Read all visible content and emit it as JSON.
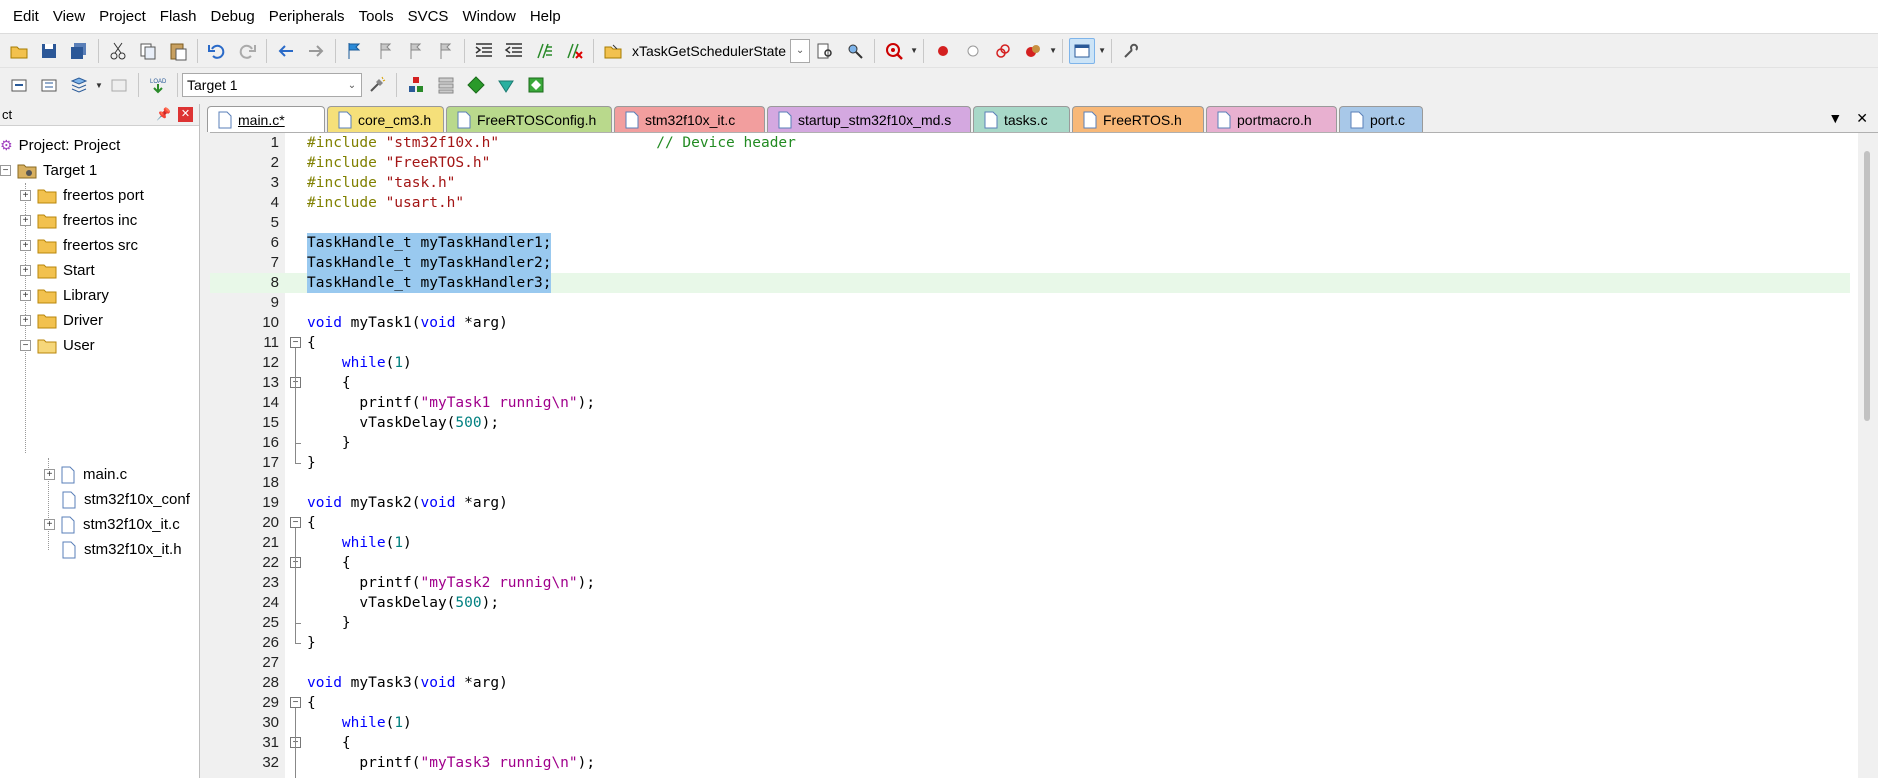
{
  "menu": [
    "Edit",
    "View",
    "Project",
    "Flash",
    "Debug",
    "Peripherals",
    "Tools",
    "SVCS",
    "Window",
    "Help"
  ],
  "toolbar": {
    "function_combo": "xTaskGetSchedulerState",
    "target_combo": "Target 1"
  },
  "project_panel": {
    "title": "ct",
    "pin": "📌",
    "close": "✕",
    "root": "Project: Project",
    "target": "Target 1",
    "groups": [
      "freertos port",
      "freertos inc",
      "freertos src",
      "Start",
      "Library",
      "Driver",
      "User"
    ],
    "user_files": [
      "main.c",
      "stm32f10x_conf",
      "stm32f10x_it.c",
      "stm32f10x_it.h"
    ]
  },
  "tabs": [
    {
      "label": "main.c*",
      "color": "#ffffff",
      "active": true
    },
    {
      "label": "core_cm3.h",
      "color": "#f5e07a"
    },
    {
      "label": "FreeRTOSConfig.h",
      "color": "#b9d98c"
    },
    {
      "label": "stm32f10x_it.c",
      "color": "#f29e9e"
    },
    {
      "label": "startup_stm32f10x_md.s",
      "color": "#d4a8e0"
    },
    {
      "label": "tasks.c",
      "color": "#a8d8c8"
    },
    {
      "label": "FreeRTOS.h",
      "color": "#f8b878"
    },
    {
      "label": "portmacro.h",
      "color": "#e8b0d0"
    },
    {
      "label": "port.c",
      "color": "#a8c8e8"
    }
  ],
  "tab_tools": {
    "dropdown": "▼",
    "close": "✕"
  },
  "editor": {
    "lines": [
      {
        "n": "1",
        "segs": [
          [
            "pp",
            "#include "
          ],
          [
            "str",
            "\"stm32f10x.h\""
          ],
          [
            "",
            "                  "
          ],
          [
            "cmt",
            "// Device header"
          ]
        ]
      },
      {
        "n": "2",
        "segs": [
          [
            "pp",
            "#include "
          ],
          [
            "str",
            "\"FreeRTOS.h\""
          ]
        ]
      },
      {
        "n": "3",
        "segs": [
          [
            "pp",
            "#include "
          ],
          [
            "str",
            "\"task.h\""
          ]
        ]
      },
      {
        "n": "4",
        "segs": [
          [
            "pp",
            "#include "
          ],
          [
            "str",
            "\"usart.h\""
          ]
        ]
      },
      {
        "n": "5",
        "segs": []
      },
      {
        "n": "6",
        "segs": [
          [
            "",
            "TaskHandle_t myTaskHandler1;"
          ]
        ],
        "sel": true
      },
      {
        "n": "7",
        "segs": [
          [
            "",
            "TaskHandle_t myTaskHandler2;"
          ]
        ],
        "sel": true
      },
      {
        "n": "8",
        "segs": [
          [
            "",
            "TaskHandle_t myTaskHandler3;"
          ]
        ],
        "sel": true,
        "current": true
      },
      {
        "n": "9",
        "segs": []
      },
      {
        "n": "10",
        "segs": [
          [
            "kw",
            "void"
          ],
          [
            "",
            " myTask1("
          ],
          [
            "kw",
            "void"
          ],
          [
            "",
            " *arg)"
          ]
        ]
      },
      {
        "n": "11",
        "segs": [
          [
            "",
            "{"
          ]
        ],
        "fold": "open"
      },
      {
        "n": "12",
        "segs": [
          [
            "",
            "    "
          ],
          [
            "kw",
            "while"
          ],
          [
            "",
            "("
          ],
          [
            "num",
            "1"
          ],
          [
            "",
            ")"
          ]
        ]
      },
      {
        "n": "13",
        "segs": [
          [
            "",
            "    {"
          ]
        ],
        "fold": "open"
      },
      {
        "n": "14",
        "segs": [
          [
            "",
            "      printf("
          ],
          [
            "str2",
            "\"myTask1 runnig\\n\""
          ],
          [
            "",
            ");"
          ]
        ]
      },
      {
        "n": "15",
        "segs": [
          [
            "",
            "      vTaskDelay("
          ],
          [
            "num",
            "500"
          ],
          [
            "",
            ");"
          ]
        ]
      },
      {
        "n": "16",
        "segs": [
          [
            "",
            "    }"
          ]
        ]
      },
      {
        "n": "17",
        "segs": [
          [
            "",
            "}"
          ]
        ]
      },
      {
        "n": "18",
        "segs": []
      },
      {
        "n": "19",
        "segs": [
          [
            "kw",
            "void"
          ],
          [
            "",
            " myTask2("
          ],
          [
            "kw",
            "void"
          ],
          [
            "",
            " *arg)"
          ]
        ]
      },
      {
        "n": "20",
        "segs": [
          [
            "",
            "{"
          ]
        ],
        "fold": "open"
      },
      {
        "n": "21",
        "segs": [
          [
            "",
            "    "
          ],
          [
            "kw",
            "while"
          ],
          [
            "",
            "("
          ],
          [
            "num",
            "1"
          ],
          [
            "",
            ")"
          ]
        ]
      },
      {
        "n": "22",
        "segs": [
          [
            "",
            "    {"
          ]
        ],
        "fold": "open"
      },
      {
        "n": "23",
        "segs": [
          [
            "",
            "      printf("
          ],
          [
            "str2",
            "\"myTask2 runnig\\n\""
          ],
          [
            "",
            ");"
          ]
        ]
      },
      {
        "n": "24",
        "segs": [
          [
            "",
            "      vTaskDelay("
          ],
          [
            "num",
            "500"
          ],
          [
            "",
            ");"
          ]
        ]
      },
      {
        "n": "25",
        "segs": [
          [
            "",
            "    }"
          ]
        ]
      },
      {
        "n": "26",
        "segs": [
          [
            "",
            "}"
          ]
        ]
      },
      {
        "n": "27",
        "segs": []
      },
      {
        "n": "28",
        "segs": [
          [
            "kw",
            "void"
          ],
          [
            "",
            " myTask3("
          ],
          [
            "kw",
            "void"
          ],
          [
            "",
            " *arg)"
          ]
        ]
      },
      {
        "n": "29",
        "segs": [
          [
            "",
            "{"
          ]
        ],
        "fold": "open"
      },
      {
        "n": "30",
        "segs": [
          [
            "",
            "    "
          ],
          [
            "kw",
            "while"
          ],
          [
            "",
            "("
          ],
          [
            "num",
            "1"
          ],
          [
            "",
            ")"
          ]
        ]
      },
      {
        "n": "31",
        "segs": [
          [
            "",
            "    {"
          ]
        ],
        "fold": "open"
      },
      {
        "n": "32",
        "segs": [
          [
            "",
            "      printf("
          ],
          [
            "str2",
            "\"myTask3 runnig\\n\""
          ],
          [
            "",
            ");"
          ]
        ]
      }
    ]
  }
}
